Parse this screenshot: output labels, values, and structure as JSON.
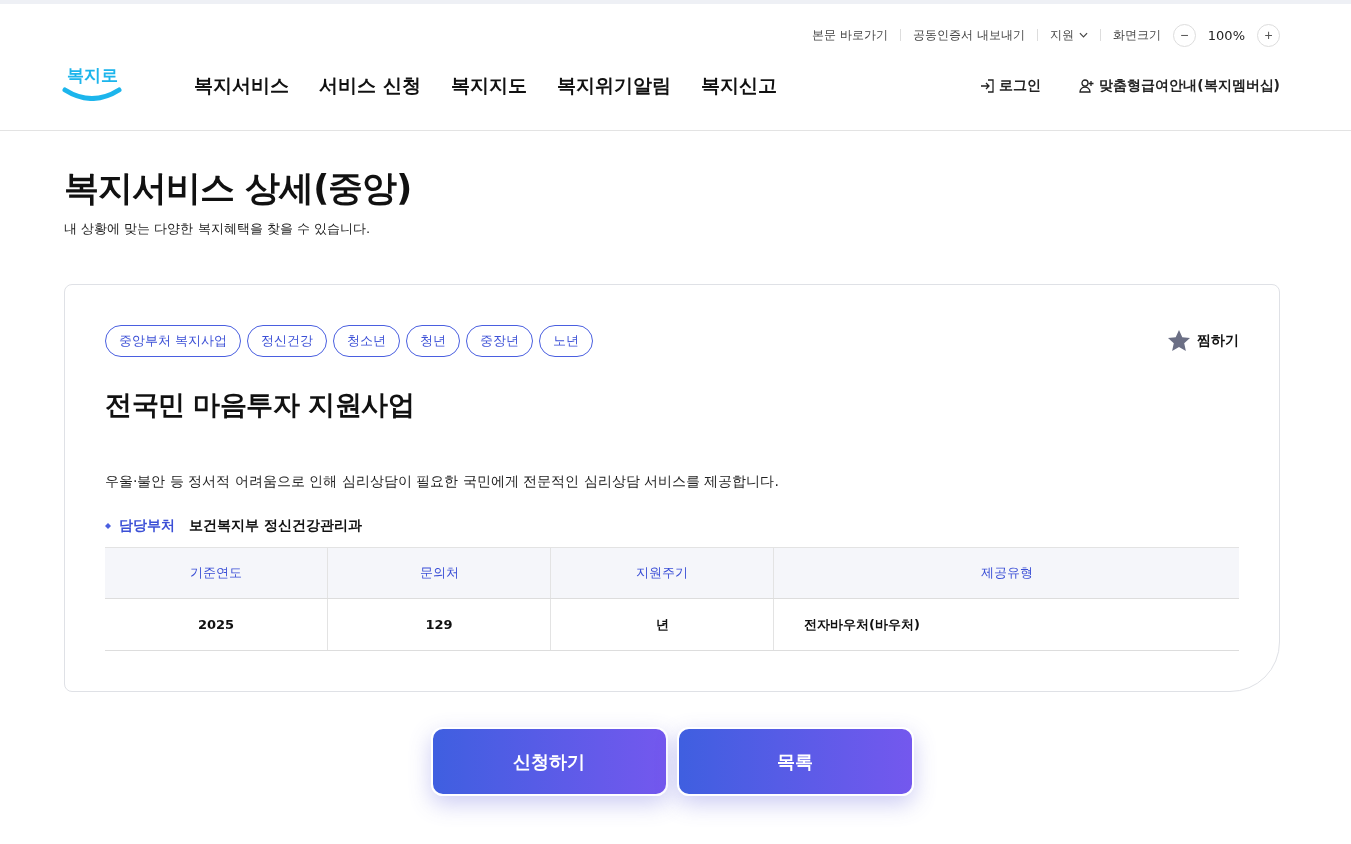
{
  "utility_links": [
    "본문 바로가기",
    "공동인증서 내보내기"
  ],
  "support_menu": {
    "label": "지원"
  },
  "zoom": {
    "label": "화면크기",
    "minus": "−",
    "value": "100%",
    "plus": "+"
  },
  "logo": "복지로",
  "nav": [
    "복지서비스",
    "서비스 신청",
    "복지지도",
    "복지위기알림",
    "복지신고"
  ],
  "account": {
    "login": "로그인",
    "membership": "맞춤형급여안내(복지멤버십)"
  },
  "page": {
    "title": "복지서비스 상세(중앙)",
    "subtitle": "내 상황에 맞는 다양한 복지혜택을 찾을 수 있습니다."
  },
  "service": {
    "tags": [
      "중앙부처 복지사업",
      "정신건강",
      "청소년",
      "청년",
      "중장년",
      "노년"
    ],
    "favorite": {
      "label": "찜하기",
      "favorited": false
    },
    "title": "전국민 마음투자 지원사업",
    "description": "우울·불안 등 정서적 어려움으로 인해 심리상담이 필요한 국민에게 전문적인 심리상담 서비스를 제공합니다.",
    "department": {
      "label": "담당부처",
      "value": "보건복지부 정신건강관리과"
    },
    "table": {
      "columns": [
        "기준연도",
        "문의처",
        "지원주기",
        "제공유형"
      ],
      "rows": [
        [
          "2025",
          "129",
          "년",
          "전자바우처(바우처)"
        ]
      ]
    }
  },
  "buttons": [
    "신청하기",
    "목록"
  ]
}
